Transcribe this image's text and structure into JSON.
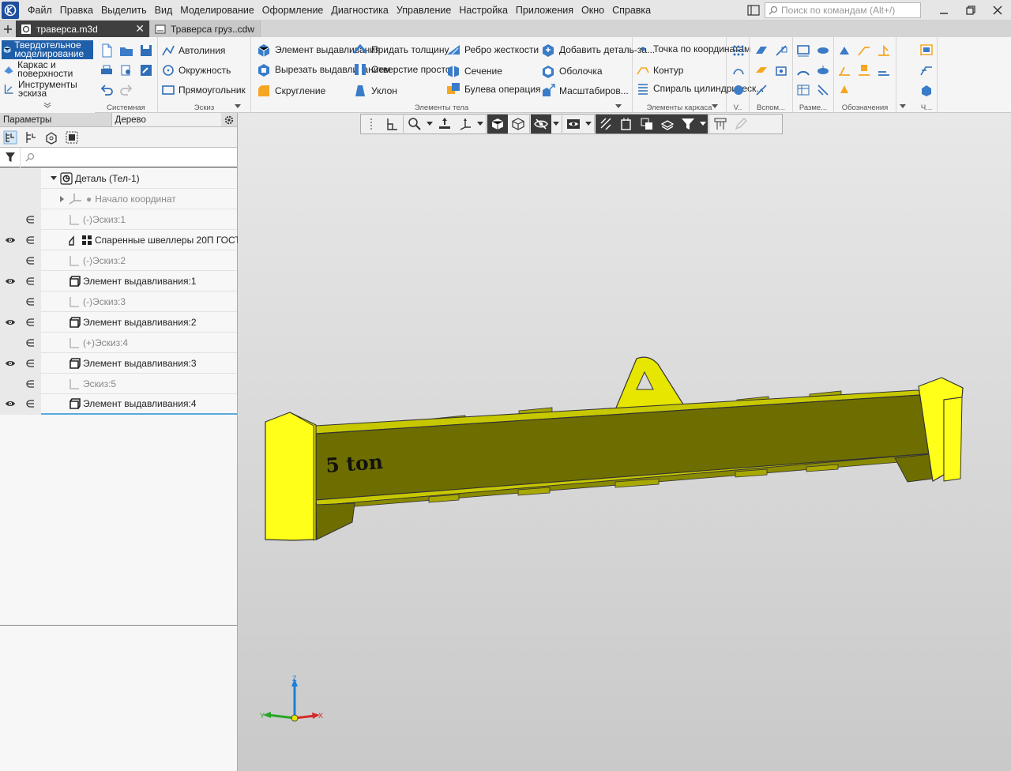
{
  "menu": {
    "items": [
      "Файл",
      "Правка",
      "Выделить",
      "Вид",
      "Моделирование",
      "Оформление",
      "Диагностика",
      "Управление",
      "Настройка",
      "Приложения",
      "Окно",
      "Справка"
    ],
    "search_placeholder": "Поиск по командам (Alt+/)"
  },
  "tabs": [
    {
      "label": "траверса.m3d",
      "active": true
    },
    {
      "label": "Траверса груз..cdw",
      "active": false
    }
  ],
  "ribbon": {
    "modes": [
      "Твердотельное моделирование",
      "Каркас и поверхности",
      "Инструменты эскиза"
    ],
    "groups": {
      "system": "Системная",
      "sketch": "Эскиз",
      "body": "Элементы тела",
      "frame": "Элементы каркаса",
      "v": "V..",
      "aux": "Вспом...",
      "dim": "Разме...",
      "notation": "Обозначения",
      "ch": "Ч..."
    },
    "sketch_buttons": [
      "Автолиния",
      "Окружность",
      "Прямоугольник"
    ],
    "body_buttons": [
      "Элемент выдавливания",
      "Вырезать выдавливанием",
      "Скругление",
      "Придать толщину",
      "Отверстие простое",
      "Уклон",
      "Ребро жесткости",
      "Сечение",
      "Булева операция",
      "Добавить деталь-за...",
      "Оболочка",
      "Масштабиров..."
    ],
    "frame_buttons": [
      "Точка по координатам",
      "Контур",
      "Спираль цилиндрическ..."
    ]
  },
  "panel": {
    "tab_params": "Параметры",
    "tab_tree": "Дерево"
  },
  "tree": {
    "root": "Деталь (Тел-1)",
    "origin": "Начало координат",
    "items": [
      {
        "label": "Эскиз:1",
        "visible": false,
        "kind": "sketch"
      },
      {
        "label": "Спаренные швеллеры 20П ГОСТ",
        "visible": true,
        "kind": "lib"
      },
      {
        "label": "Эскиз:2",
        "visible": false,
        "kind": "sketch"
      },
      {
        "label": "Элемент выдавливания:1",
        "visible": true,
        "kind": "extrude"
      },
      {
        "label": "Эскиз:3",
        "visible": false,
        "kind": "sketch"
      },
      {
        "label": "Элемент выдавливания:2",
        "visible": true,
        "kind": "extrude"
      },
      {
        "label": "Эскиз:4",
        "visible": false,
        "kind": "sketch"
      },
      {
        "label": "Элемент выдавливания:3",
        "visible": true,
        "kind": "extrude"
      },
      {
        "label": "Эскиз:5",
        "visible": false,
        "kind": "sketch"
      },
      {
        "label": "Элемент выдавливания:4",
        "visible": true,
        "kind": "extrude",
        "selected": true
      }
    ],
    "sketch_prefixes": [
      "(-)",
      "",
      "(-)",
      "",
      "(-)",
      "",
      "(+)",
      "",
      "",
      ""
    ]
  },
  "model": {
    "engraving": "5 ton",
    "colors": {
      "body": "#6e6e00",
      "plate": "#ffff1a",
      "accent": "#c8c800"
    }
  },
  "axes": {
    "z": "Z",
    "y": "Y",
    "x": "X"
  }
}
